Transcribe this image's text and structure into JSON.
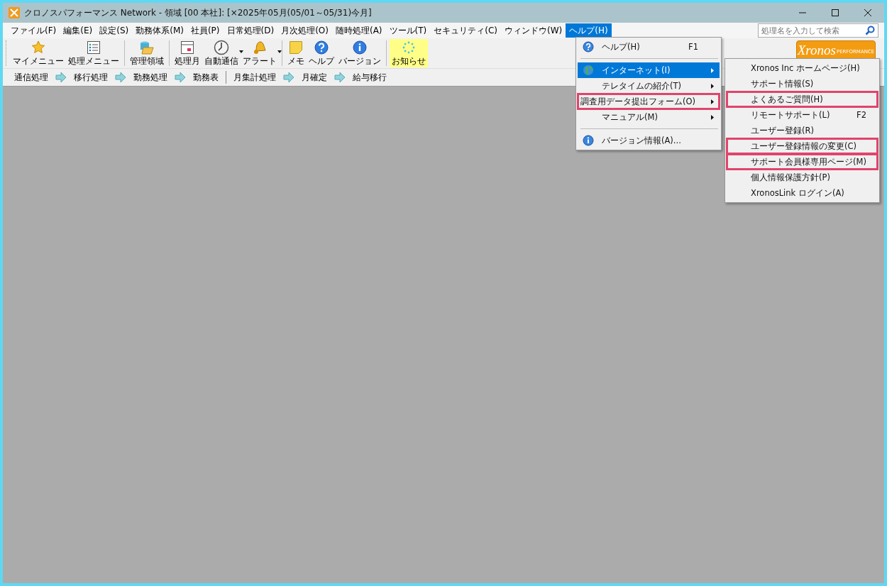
{
  "window": {
    "title": "クロノスパフォーマンス Network - 領域 [00 本社]: [×2025年05月(05/01～05/31)今月]"
  },
  "menu_bar": [
    {
      "label": "ファイル(F)",
      "selected": false
    },
    {
      "label": "編集(E)",
      "selected": false
    },
    {
      "label": "設定(S)",
      "selected": false
    },
    {
      "label": "勤務体系(M)",
      "selected": false
    },
    {
      "label": "社員(P)",
      "selected": false
    },
    {
      "label": "日常処理(D)",
      "selected": false
    },
    {
      "label": "月次処理(O)",
      "selected": false
    },
    {
      "label": "随時処理(A)",
      "selected": false
    },
    {
      "label": "ツール(T)",
      "selected": false
    },
    {
      "label": "セキュリティ(C)",
      "selected": false
    },
    {
      "label": "ウィンドウ(W)",
      "selected": false
    },
    {
      "label": "ヘルプ(H)",
      "selected": true
    }
  ],
  "search": {
    "placeholder": "処理名を入力して検索"
  },
  "toolbar": [
    {
      "kind": "star",
      "label": "マイメニュー",
      "dropdown": false,
      "highlighted": false
    },
    {
      "kind": "list",
      "label": "処理メニュー",
      "dropdown": false,
      "highlighted": false
    },
    {
      "kind": "separator"
    },
    {
      "kind": "database",
      "label": "管理領域",
      "dropdown": false,
      "highlighted": false
    },
    {
      "kind": "separator"
    },
    {
      "kind": "calendar",
      "label": "処理月",
      "dropdown": false,
      "highlighted": false
    },
    {
      "kind": "clock",
      "label": "自動通信",
      "dropdown": true,
      "highlighted": false
    },
    {
      "kind": "bell",
      "label": "アラート",
      "dropdown": true,
      "highlighted": false
    },
    {
      "kind": "separator"
    },
    {
      "kind": "note",
      "label": "メモ",
      "dropdown": false,
      "highlighted": false
    },
    {
      "kind": "help",
      "label": "ヘルプ",
      "dropdown": false,
      "highlighted": false
    },
    {
      "kind": "info",
      "label": "バージョン",
      "dropdown": false,
      "highlighted": false
    },
    {
      "kind": "separator"
    },
    {
      "kind": "spinner",
      "label": "お知らせ",
      "dropdown": false,
      "highlighted": true
    }
  ],
  "logo": {
    "text": "Xronos",
    "subtext": "PERFORMANCE"
  },
  "workflow": [
    {
      "kind": "step",
      "label": "通信処理"
    },
    {
      "kind": "arrow"
    },
    {
      "kind": "step",
      "label": "移行処理"
    },
    {
      "kind": "arrow"
    },
    {
      "kind": "step",
      "label": "勤務処理"
    },
    {
      "kind": "arrow"
    },
    {
      "kind": "step",
      "label": "勤務表"
    },
    {
      "kind": "separator"
    },
    {
      "kind": "step",
      "label": "月集計処理"
    },
    {
      "kind": "arrow"
    },
    {
      "kind": "step",
      "label": "月確定"
    },
    {
      "kind": "arrow"
    },
    {
      "kind": "step",
      "label": "給与移行"
    }
  ],
  "help_menu": [
    {
      "kind": "help_item",
      "label": "ヘルプ(H)",
      "shortcut": "F1",
      "submenu": false,
      "selected": false,
      "annotated": false
    },
    {
      "kind": "separator"
    },
    {
      "kind": "globe_item",
      "label": "インターネット(I)",
      "submenu": true,
      "selected": true,
      "annotated": false
    },
    {
      "kind": "item",
      "label": "テレタイムの紹介(T)",
      "submenu": true,
      "selected": false,
      "annotated": false
    },
    {
      "kind": "item",
      "label": "調査用データ提出フォーム(O)",
      "submenu": true,
      "selected": false,
      "annotated": true
    },
    {
      "kind": "item",
      "label": "マニュアル(M)",
      "submenu": true,
      "selected": false,
      "annotated": false
    },
    {
      "kind": "separator"
    },
    {
      "kind": "info_item",
      "label": "バージョン情報(A)...",
      "submenu": false,
      "selected": false,
      "annotated": false
    }
  ],
  "internet_submenu": [
    {
      "label": "Xronos Inc ホームページ(H)",
      "selected": false,
      "annotated": false
    },
    {
      "label": "サポート情報(S)",
      "selected": false,
      "annotated": false
    },
    {
      "label": "よくあるご質問(H)",
      "selected": false,
      "annotated": true
    },
    {
      "label": "リモートサポート(L)",
      "shortcut": "F2",
      "selected": false,
      "annotated": false
    },
    {
      "label": "ユーザー登録(R)",
      "selected": false,
      "annotated": false
    },
    {
      "label": "ユーザー登録情報の変更(C)",
      "selected": false,
      "annotated": true
    },
    {
      "label": "サポート会員様専用ページ(M)",
      "selected": false,
      "annotated": true
    },
    {
      "label": "個人情報保護方針(P)",
      "selected": false,
      "annotated": false
    },
    {
      "label": "XronosLink ログイン(A)",
      "selected": false,
      "annotated": false
    }
  ]
}
